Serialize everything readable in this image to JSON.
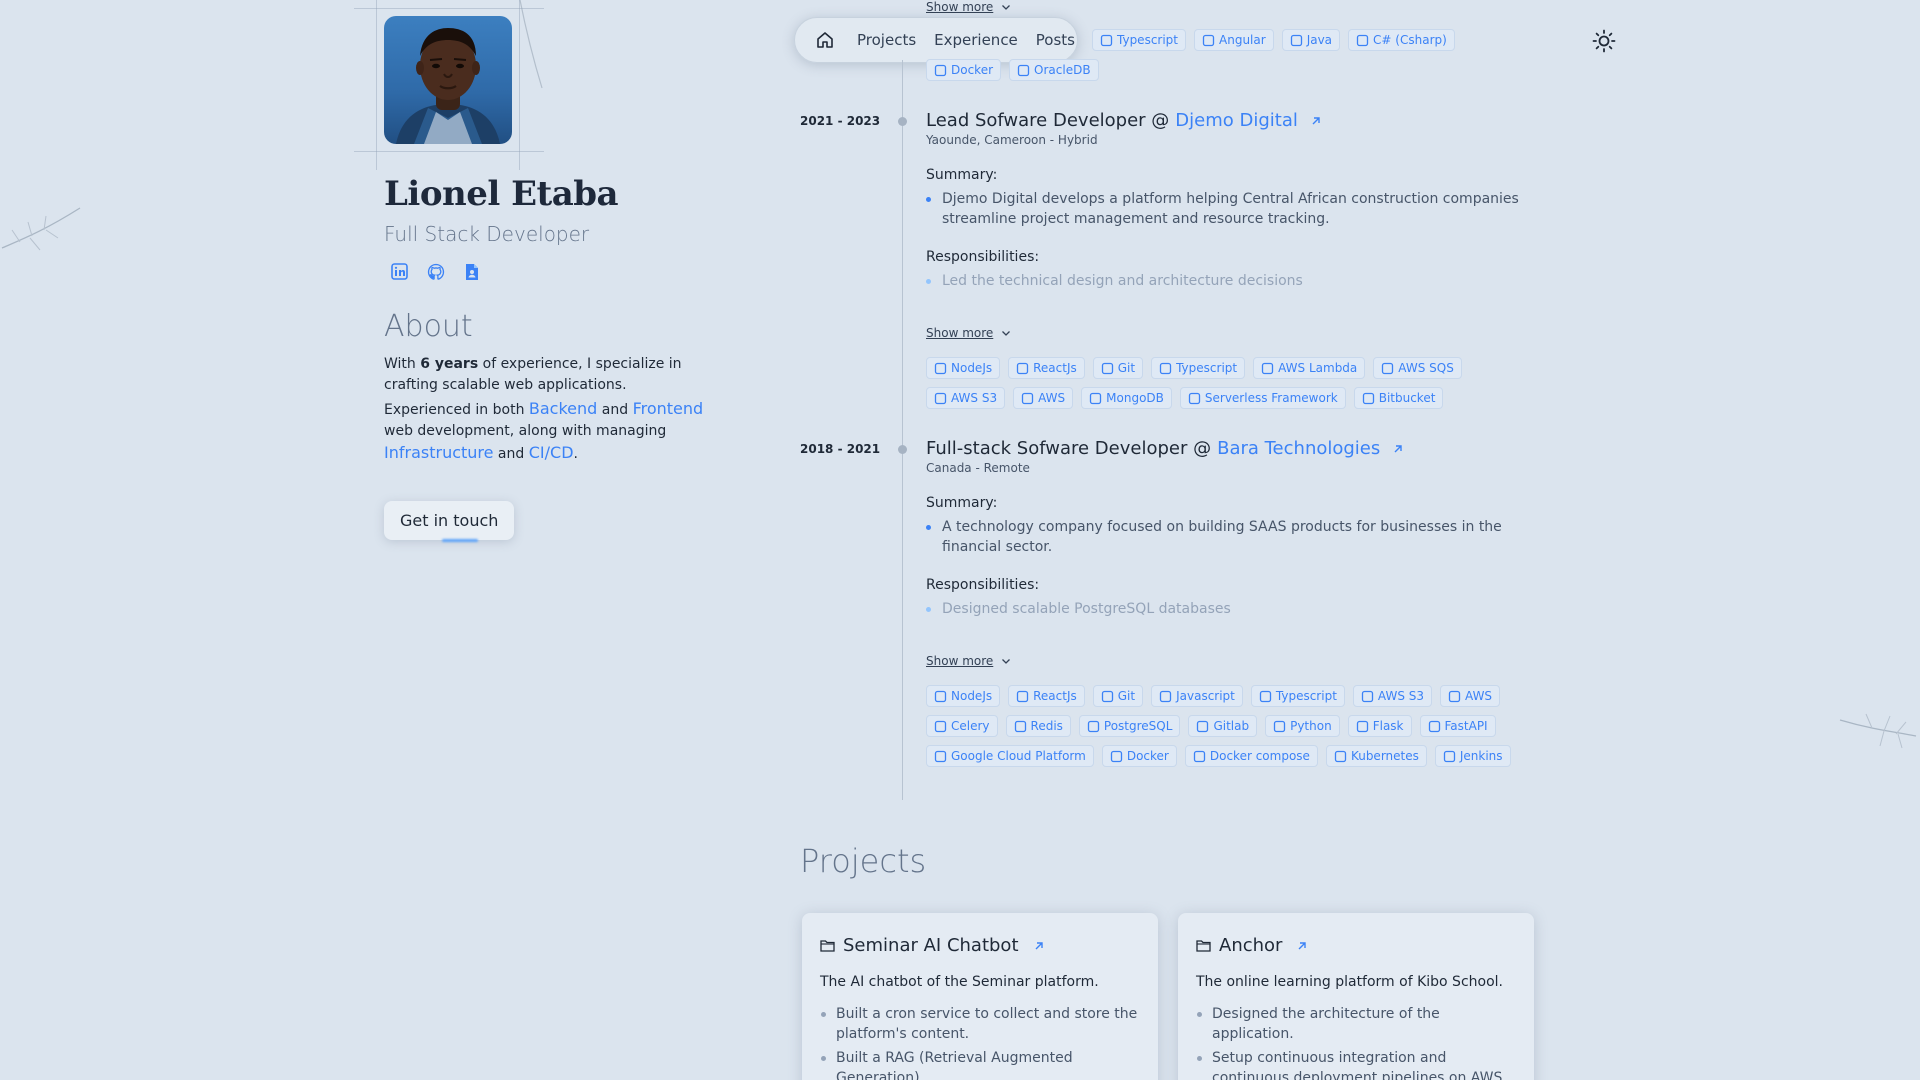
{
  "nav": {
    "items": [
      {
        "label": "Projects"
      },
      {
        "label": "Experience"
      },
      {
        "label": "Posts"
      }
    ]
  },
  "profile": {
    "name": "Lionel Etaba",
    "role": "Full Stack Developer",
    "about_title": "About",
    "about": {
      "p1_a": "With ",
      "p1_b": "6 years",
      "p1_c": " of experience, I specialize in crafting scalable web applications.",
      "p2_a": "Experienced in both ",
      "p2_backend": "Backend",
      "p2_and": " and ",
      "p2_frontend": "Frontend",
      "p2_b": " web development, along with managing ",
      "p2_infra": "Infrastructure",
      "p2_and2": " and ",
      "p2_cicd": "CI/CD",
      "p2_end": "."
    },
    "cta": "Get in touch"
  },
  "experience": {
    "top_show_more": "Show more",
    "top_tags_row1": [
      "Typescript",
      "Angular",
      "Java",
      "C# (Csharp)"
    ],
    "top_tags_row2": [
      "Docker",
      "OracleDB"
    ],
    "jobs": [
      {
        "date": "2021 - 2023",
        "role": "Lead Sofware Developer @ ",
        "company": "Djemo Digital",
        "location": "Yaounde, Cameroon - Hybrid",
        "summary_label": "Summary:",
        "summary": "Djemo Digital develops a platform helping Central African construction companies streamline project management and resource tracking.",
        "resp_label": "Responsibilities:",
        "responsibilities": [
          "Led the technical design and architecture decisions"
        ],
        "show_more": "Show more",
        "tags": [
          "NodeJs",
          "ReactJs",
          "Git",
          "Typescript",
          "AWS Lambda",
          "AWS SQS",
          "AWS S3",
          "AWS",
          "MongoDB",
          "Serverless Framework",
          "Bitbucket"
        ]
      },
      {
        "date": "2018 - 2021",
        "role": "Full-stack Sofware Developer @ ",
        "company": "Bara Technologies",
        "location": "Canada - Remote",
        "summary_label": "Summary:",
        "summary": "A technology company focused on building SAAS products for businesses in the financial sector.",
        "resp_label": "Responsibilities:",
        "responsibilities": [
          "Designed scalable PostgreSQL databases"
        ],
        "show_more": "Show more",
        "tags": [
          "NodeJs",
          "ReactJs",
          "Git",
          "Javascript",
          "Typescript",
          "AWS S3",
          "AWS",
          "Celery",
          "Redis",
          "PostgreSQL",
          "Gitlab",
          "Python",
          "Flask",
          "FastAPI",
          "Google Cloud Platform",
          "Docker",
          "Docker compose",
          "Kubernetes",
          "Jenkins"
        ]
      }
    ]
  },
  "projects": {
    "title": "Projects",
    "cards": [
      {
        "title": "Seminar AI Chatbot",
        "desc": "The AI chatbot of the Seminar platform.",
        "bullets": [
          "Built a cron service to collect and store the platform's content.",
          "Built a RAG (Retrieval Augmented Generation)"
        ]
      },
      {
        "title": "Anchor",
        "desc": "The online learning platform of Kibo School.",
        "bullets": [
          "Designed the architecture of the application.",
          "Setup continuous integration and continuous deployment pipelines on AWS."
        ]
      }
    ]
  },
  "colors": {
    "background": "#dbe4ee",
    "accent": "#3b82f6",
    "tag_bg": "#dfe9f5"
  },
  "icons": {
    "socials": [
      "linkedin-icon",
      "github-icon",
      "resume-icon"
    ],
    "nav_home": "home-icon",
    "theme": "sun-icon"
  }
}
